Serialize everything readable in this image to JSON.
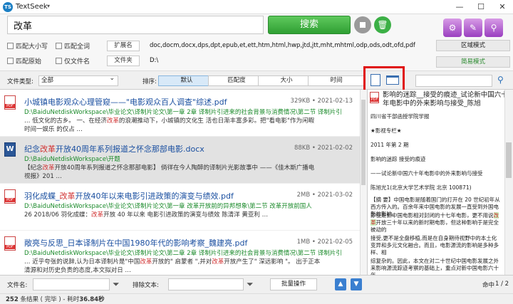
{
  "window": {
    "title": "TextSeek",
    "controls": [
      "—",
      "☐",
      "✕"
    ]
  },
  "search": {
    "query": "改革",
    "button_label": "搜索",
    "opt_case": "匹配大小写",
    "opt_fullword": "匹配全词",
    "opt_original": "匹配原始",
    "opt_filename_only": "仅文件名",
    "ext_label": "扩展名",
    "ext_value": "doc,docm,docx,dps,dpt,epub,et,ett,htm,html,hwp,jtd,jtt,mht,mhtml,odp,ods,odt,ofd,pdf",
    "folder_label": "文件夹",
    "folder_value": "D:\\",
    "zone_mode": "区域模式",
    "simple_mode": "简易模式"
  },
  "sortbar": {
    "filetype_label": "文件类型:",
    "filetype_value": "全部",
    "sort_label": "排序:",
    "sort_default": "默认",
    "sort_match": "匹配度",
    "sort_size": "大小",
    "sort_time": "时间"
  },
  "results": [
    {
      "type": "pdf",
      "title_pre": "小城镇电影观众心理管窥——\"电影观众百人调查\"综述.pdf",
      "title_hl": "",
      "title_post": "",
      "size": "329KB",
      "date": "2021-02-13",
      "path": "D:\\BaiduNetdiskWorkspace\\毕业论文\\译制片论文\\第一章 2章 译制片引进来的社会背景与消费情况\\第二节 译制片引",
      "snip1_pre": "… 低文化的古乡。 一、在经济",
      "snip1_hl": "改革",
      "snip1_post": "的浪潮推动下，小城镇的文化生 活也日渐丰富多彩。把\"看电影\"作为闲暇",
      "snip2": "时间一娱乐 的仅占 …"
    },
    {
      "type": "doc",
      "title_pre": "纪念",
      "title_hl": "改革",
      "title_post": "开放40周年系列报道之怀念那部电影.docx",
      "size": "88KB",
      "date": "2021-02-02",
      "path": "D:\\BaiduNetdiskWorkspace\\开题",
      "snip1_pre": "【纪念",
      "snip1_hl": "改革",
      "snip1_post": "开放40周年系列报道之怀念那部电影】 倘徉在今人陶醉的译制片光影故事中 ——《佳木斯广播电",
      "snip2": "视报》201 …"
    },
    {
      "type": "pdf",
      "title_pre": "羽化成蝶_",
      "title_hl": "改革",
      "title_post": "开放40年以来电影引进政策的演变与绩效.pdf",
      "size": "2MB",
      "date": "2021-03-02",
      "path": "D:\\BaiduNetdiskWorkspace\\毕业论文\\译制片论文\\第一章 改革开放前的异邦想象\\第二节 改革开放前国人",
      "snip1_pre": "26 2018/06 羽化成蝶：",
      "snip1_hl": "改革",
      "snip1_post": "开放 40 年以来 电影引进政策的演变与绩效 陈清洋 黄亚利 …",
      "snip2": ""
    },
    {
      "type": "pdf",
      "title_pre": "敞亮与反思_日本译制片在中国1980年代的影响考察_魏建亮.pdf",
      "title_hl": "",
      "title_post": "",
      "size": "1MB",
      "date": "2021-02-05",
      "path": "D:\\BaiduNetdiskWorkspace\\毕业论文\\译制片论文\\第二章 2章 译制片引进来的社会背景与消费情况\\第二节 译制片引",
      "snip1_pre": "… 近乎夸张的说辞,认为日本译制片是\"中国",
      "snip1_hl": "改革",
      "snip1_post": "开放的\" 启蒙者 \",并对",
      "snip1_post2": "改革",
      "snip1_post3": "开放产生了\" 深远影响 \"。 出于正本",
      "snip2": "清源和对历史负责的态度,本文拟对日 …"
    }
  ],
  "preview": {
    "title": "影响的迷踪__接受的痕迹_试论新中国六十年电影中的外来影响与接受_陈旭",
    "lines": [
      "四川省干部函授学院学报",
      "★影视专栏★",
      "2011 年第 2 期",
      "影响的迷踪 接受的痕迹",
      "——试论新中国六十年电影中的外来影响与接受",
      "陈旭光1(北京大学艺术学院 北京 100871)"
    ],
    "para1": "【摘 要】中国电影是随着国门的打开在 20 世纪初年从西方传入的。百余年来中国电影的发展一直受到外国电影的影响。",
    "para2_pre": "即使是新中国电影相对封闭的十七年电影，更不用说",
    "para2_hl": "改革",
    "para2_post": "开放三十年以来的新时期电影，但这种影响于是完全被动的",
    "para3": "接受,更不是全盘移植,而是在自身期待视野中的本土化变异和多元文化融合。而且，电影源流的影响是多种多样、相",
    "para4_pre": "综复杂的。因此，本文在对二十世纪中国电影发展之外来影响源流踪迹考察的基础上，重点对新中国电影六十年"
  },
  "filterbar": {
    "filename_label": "文件名:",
    "exclude_label": "排除文本:",
    "batch_label": "批量操作",
    "up_arrow": "▲",
    "down_arrow": "▼",
    "hit_label": "命中",
    "hit_value": "1 / 2"
  },
  "status": {
    "count": "252",
    "count_label": "条结果",
    "done": "( 完毕 )",
    "elapsed_label": "- 耗时",
    "elapsed": "36.84秒"
  },
  "colors": {
    "accent": "#1a4fa0",
    "highlight": "#d03030",
    "path": "#1a8a2a",
    "search_btn": "#2f9f33",
    "focus_frame": "#e01010"
  },
  "icons": [
    "app-icon",
    "stop-icon",
    "trash-icon",
    "settings-icon",
    "folder-icon",
    "file-icon",
    "search-icon",
    "filter-icon"
  ]
}
